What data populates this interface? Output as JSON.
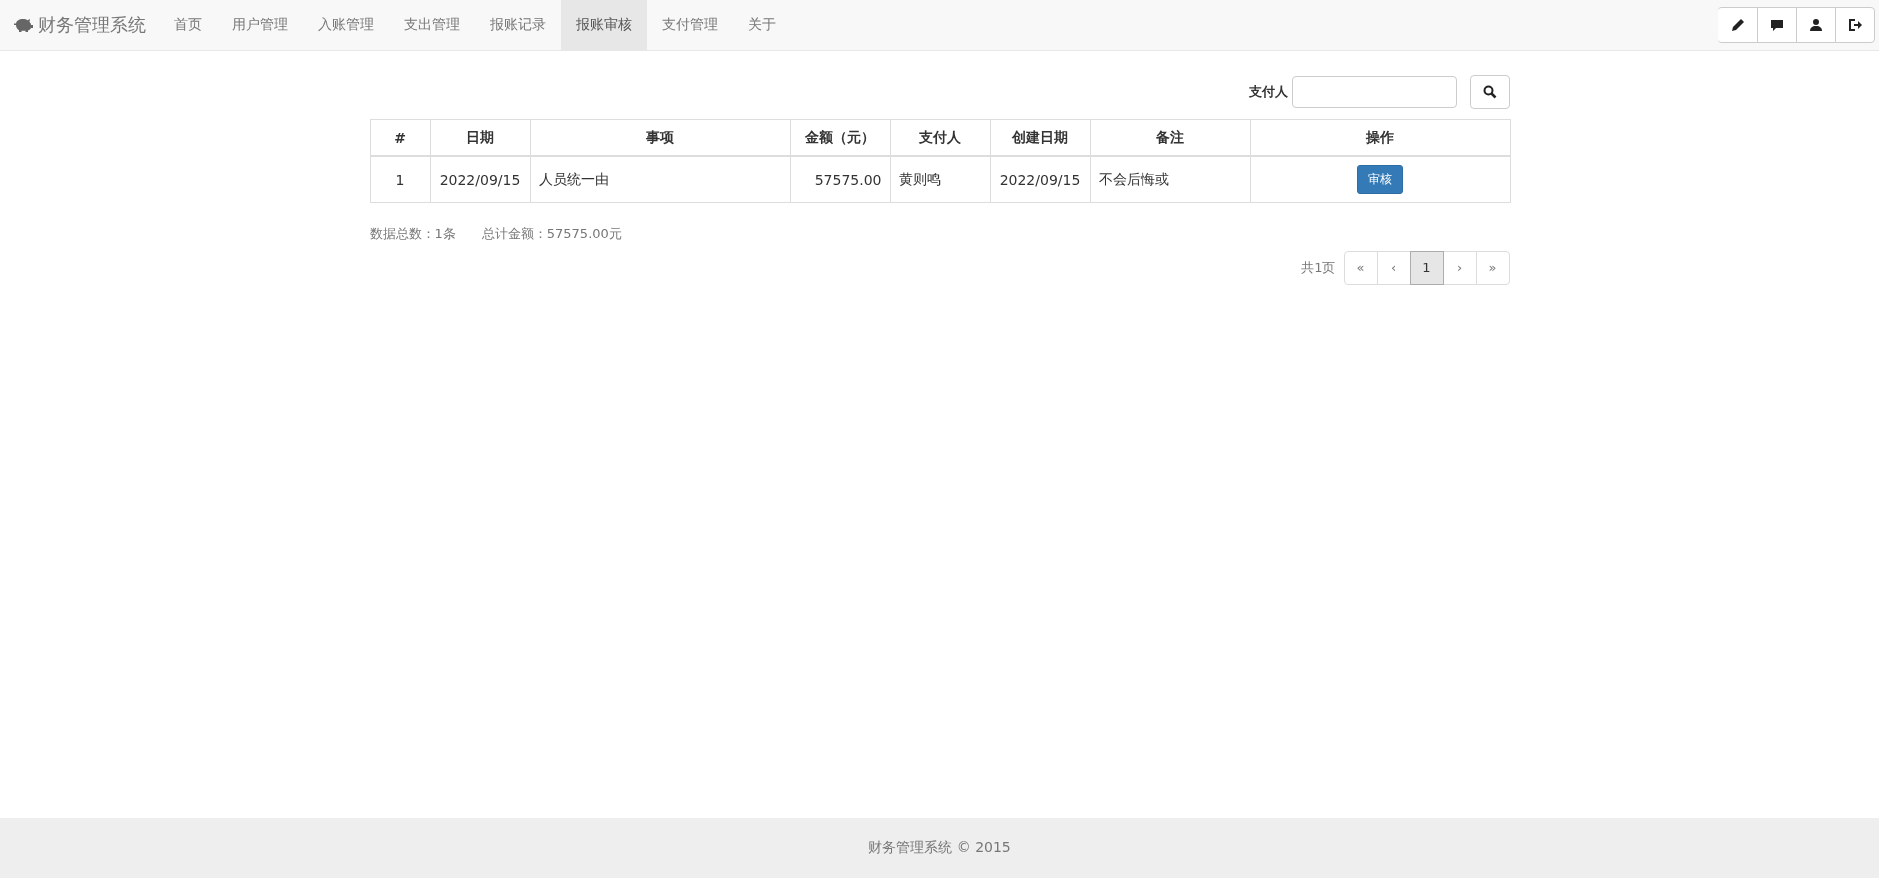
{
  "navbar": {
    "brand": "财务管理系统",
    "items": [
      {
        "label": "首页",
        "selected": false
      },
      {
        "label": "用户管理",
        "selected": false
      },
      {
        "label": "入账管理",
        "selected": false
      },
      {
        "label": "支出管理",
        "selected": false
      },
      {
        "label": "报账记录",
        "selected": false
      },
      {
        "label": "报账审核",
        "selected": true
      },
      {
        "label": "支付管理",
        "selected": false
      },
      {
        "label": "关于",
        "selected": false
      }
    ]
  },
  "search": {
    "label": "支付人"
  },
  "table": {
    "columns": [
      "#",
      "日期",
      "事项",
      "金额（元）",
      "支付人",
      "创建日期",
      "备注",
      "操作"
    ],
    "rows": [
      {
        "cells": [
          "1",
          "2022/09/15",
          "人员统一由",
          "57575.00",
          "黄则鸣",
          "2022/09/15",
          "不会后悔或"
        ],
        "action": "审核"
      }
    ]
  },
  "summary": {
    "count": "数据总数：1条",
    "total": "总计金额：57575.00元"
  },
  "pagination": {
    "info": "共1页",
    "pages": [
      {
        "label": "«",
        "selected": false
      },
      {
        "label": "‹",
        "selected": false
      },
      {
        "label": "1",
        "selected": true
      },
      {
        "label": "›",
        "selected": false
      },
      {
        "label": "»",
        "selected": false
      }
    ]
  },
  "footer": {
    "text": "财务管理系统 © 2015"
  }
}
